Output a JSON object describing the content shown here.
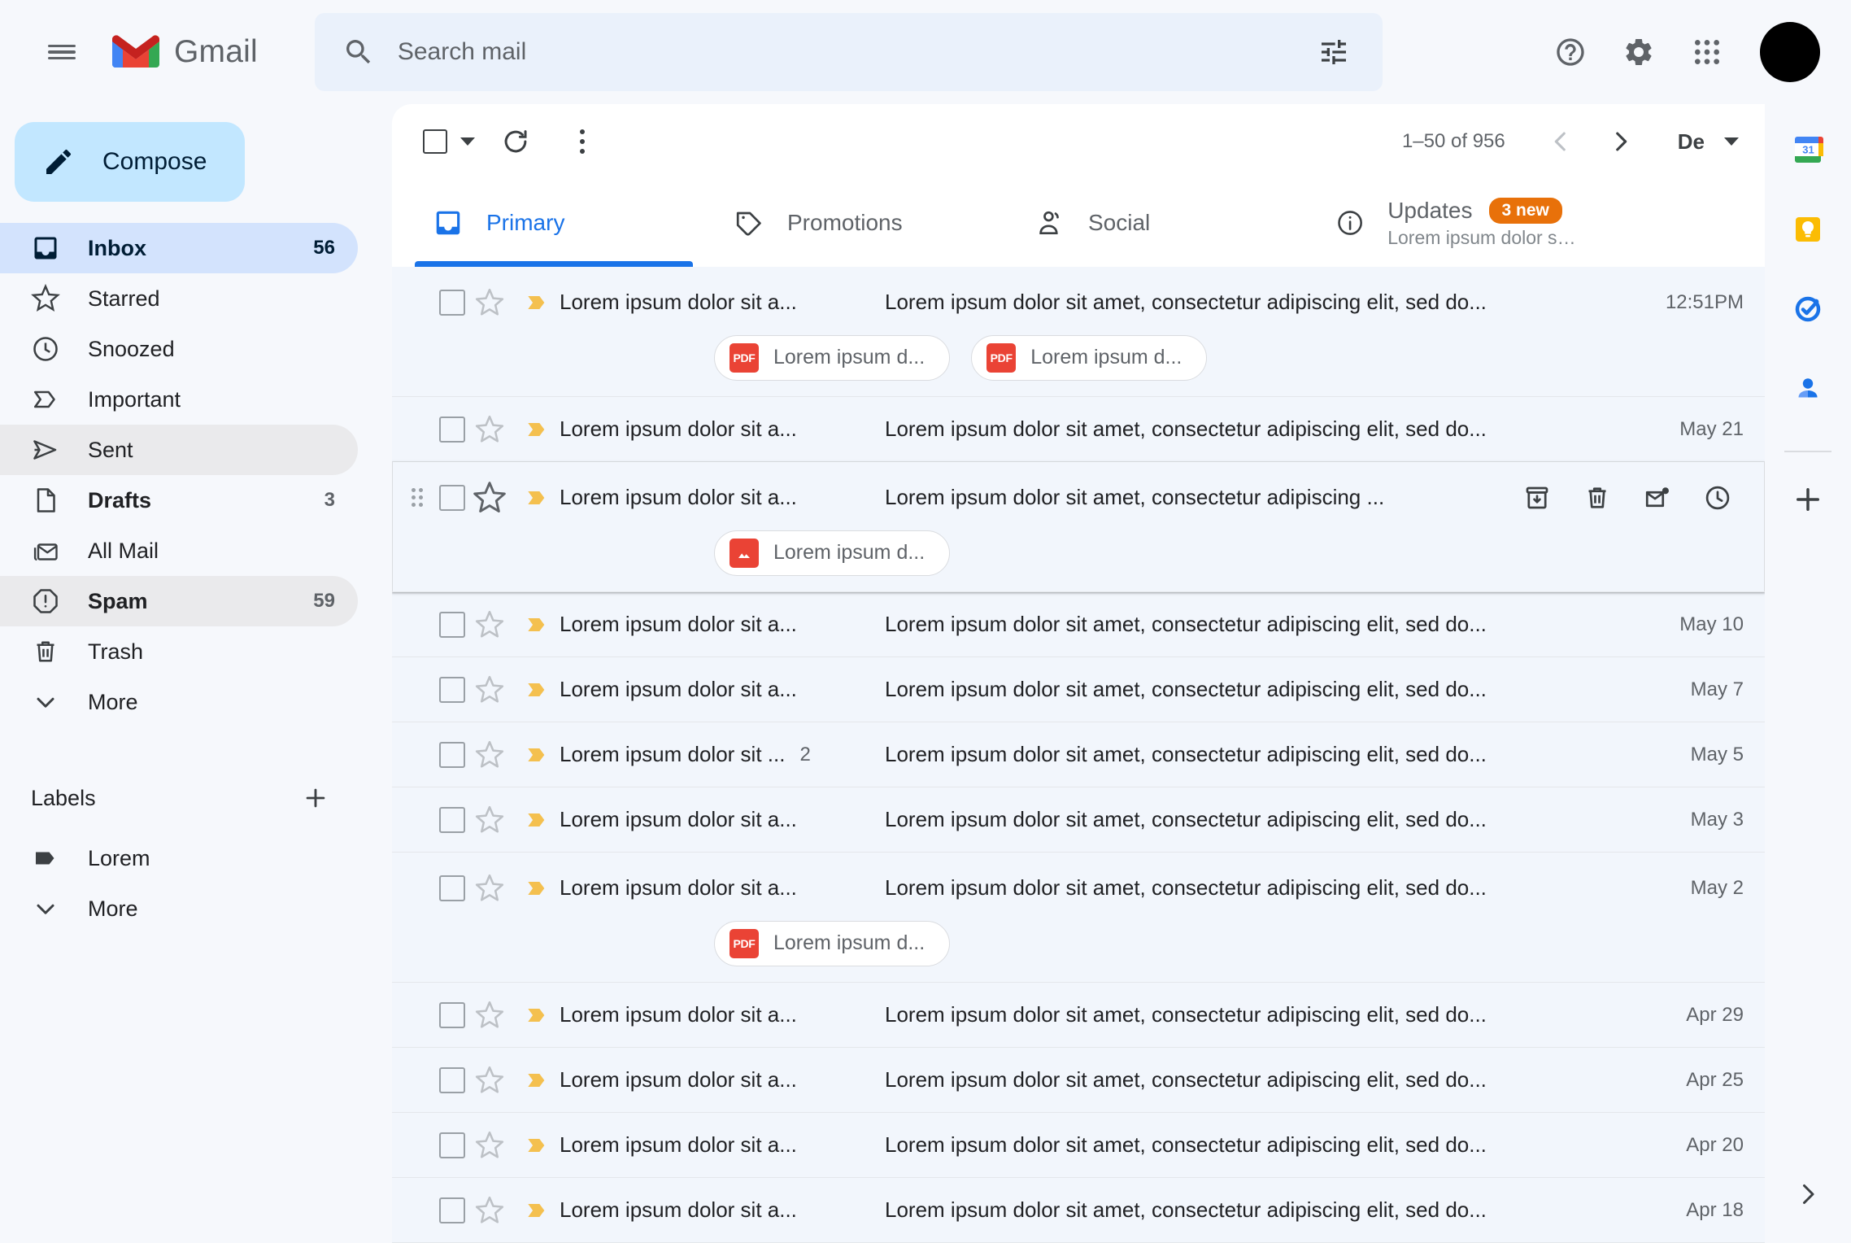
{
  "app": {
    "brand_name": "Gmail",
    "accent_blue": "#1A73E8",
    "badge_orange": "#E8710A",
    "attachment_red": "#EA4335",
    "important_yellow": "#F4C04F"
  },
  "header": {
    "menu_icon": "hamburger-icon",
    "logo_icon": "gmail-logo-icon",
    "search": {
      "icon": "search-icon",
      "placeholder": "Search mail",
      "value": "",
      "filter_icon": "tune-filter-icon"
    },
    "actions": [
      {
        "name": "help-icon",
        "label": "Support"
      },
      {
        "name": "gear-icon",
        "label": "Settings"
      },
      {
        "name": "apps-grid-icon",
        "label": "Google apps"
      }
    ],
    "avatar_label": "Account"
  },
  "sidebar": {
    "compose_label": "Compose",
    "compose_icon": "pencil-icon",
    "items": [
      {
        "label": "Inbox",
        "count": "56",
        "icon": "inbox-icon",
        "state": "active"
      },
      {
        "label": "Starred",
        "count": "",
        "icon": "star-icon",
        "state": "normal"
      },
      {
        "label": "Snoozed",
        "count": "",
        "icon": "clock-icon",
        "state": "normal"
      },
      {
        "label": "Important",
        "count": "",
        "icon": "label-important-icon",
        "state": "normal"
      },
      {
        "label": "Sent",
        "count": "",
        "icon": "send-icon",
        "state": "hovered"
      },
      {
        "label": "Drafts",
        "count": "3",
        "icon": "draft-icon",
        "state": "bold"
      },
      {
        "label": "All Mail",
        "count": "",
        "icon": "all-mail-icon",
        "state": "normal"
      },
      {
        "label": "Spam",
        "count": "59",
        "icon": "spam-icon",
        "state": "bold hovered"
      },
      {
        "label": "Trash",
        "count": "",
        "icon": "trash-icon",
        "state": "normal"
      },
      {
        "label": "More",
        "count": "",
        "icon": "chevron-down-icon",
        "state": "normal"
      }
    ],
    "labels_section": {
      "title": "Labels",
      "add_icon": "plus-icon",
      "items": [
        {
          "label": "Lorem",
          "icon": "label-tag-icon"
        },
        {
          "label": "More",
          "icon": "chevron-down-icon"
        }
      ]
    }
  },
  "toolbar": {
    "select_all_label": "Select",
    "refresh_label": "Refresh",
    "more_label": "More",
    "pager_text": "1–50 of 956",
    "prev_label": "Newer",
    "next_label": "Older",
    "sort_label": "De"
  },
  "tabs": [
    {
      "label": "Primary",
      "icon": "inbox-tab-icon",
      "active": true,
      "badge": "",
      "subtitle": ""
    },
    {
      "label": "Promotions",
      "icon": "tag-tab-icon",
      "active": false,
      "badge": "",
      "subtitle": ""
    },
    {
      "label": "Social",
      "icon": "people-tab-icon",
      "active": false,
      "badge": "",
      "subtitle": ""
    },
    {
      "label": "Updates",
      "icon": "info-tab-icon",
      "active": false,
      "badge": "3 new",
      "subtitle": "Lorem ipsum dolor sit ..."
    }
  ],
  "emails": [
    {
      "sender": "Lorem ipsum dolor sit a...",
      "thread_count": "",
      "subject": "Lorem ipsum dolor sit amet, consectetur adipiscing elit, sed do...",
      "date": "12:51PM",
      "hovered": false,
      "attachments": [
        {
          "label": "Lorem ipsum d...",
          "type": "pdf"
        },
        {
          "label": "Lorem ipsum d...",
          "type": "pdf"
        }
      ]
    },
    {
      "sender": "Lorem ipsum dolor sit a...",
      "thread_count": "",
      "subject": "Lorem ipsum dolor sit amet, consectetur adipiscing elit, sed do...",
      "date": "May 21",
      "hovered": false,
      "attachments": []
    },
    {
      "sender": "Lorem ipsum dolor sit a...",
      "thread_count": "",
      "subject": "Lorem ipsum dolor sit amet, consectetur adipiscing ...",
      "date": "",
      "hovered": true,
      "attachments": [
        {
          "label": "Lorem ipsum d...",
          "type": "image"
        }
      ]
    },
    {
      "sender": "Lorem ipsum dolor sit a...",
      "thread_count": "",
      "subject": "Lorem ipsum dolor sit amet, consectetur adipiscing elit, sed do...",
      "date": "May 10",
      "hovered": false,
      "attachments": []
    },
    {
      "sender": "Lorem ipsum dolor sit a...",
      "thread_count": "",
      "subject": "Lorem ipsum dolor sit amet, consectetur adipiscing elit, sed do...",
      "date": "May 7",
      "hovered": false,
      "attachments": []
    },
    {
      "sender": "Lorem ipsum dolor sit ...",
      "thread_count": "2",
      "subject": "Lorem ipsum dolor sit amet, consectetur adipiscing elit, sed do...",
      "date": "May 5",
      "hovered": false,
      "attachments": []
    },
    {
      "sender": "Lorem ipsum dolor sit a...",
      "thread_count": "",
      "subject": "Lorem ipsum dolor sit amet, consectetur adipiscing elit, sed do...",
      "date": "May 3",
      "hovered": false,
      "attachments": []
    },
    {
      "sender": "Lorem ipsum dolor sit a...",
      "thread_count": "",
      "subject": "Lorem ipsum dolor sit amet, consectetur adipiscing elit, sed do...",
      "date": "May 2",
      "hovered": false,
      "attachments": [
        {
          "label": "Lorem ipsum d...",
          "type": "pdf"
        }
      ]
    },
    {
      "sender": "Lorem ipsum dolor sit a...",
      "thread_count": "",
      "subject": "Lorem ipsum dolor sit amet, consectetur adipiscing elit, sed do...",
      "date": "Apr 29",
      "hovered": false,
      "attachments": []
    },
    {
      "sender": "Lorem ipsum dolor sit a...",
      "thread_count": "",
      "subject": "Lorem ipsum dolor sit amet, consectetur adipiscing elit, sed do...",
      "date": "Apr 25",
      "hovered": false,
      "attachments": []
    },
    {
      "sender": "Lorem ipsum dolor sit a...",
      "thread_count": "",
      "subject": "Lorem ipsum dolor sit amet, consectetur adipiscing elit, sed do...",
      "date": "Apr 20",
      "hovered": false,
      "attachments": []
    },
    {
      "sender": "Lorem ipsum dolor sit a...",
      "thread_count": "",
      "subject": "Lorem ipsum dolor sit amet, consectetur adipiscing elit, sed do...",
      "date": "Apr 18",
      "hovered": false,
      "attachments": []
    }
  ],
  "row_actions": [
    {
      "name": "archive-icon",
      "label": "Archive"
    },
    {
      "name": "delete-icon",
      "label": "Delete"
    },
    {
      "name": "mark-unread-icon",
      "label": "Mark as unread"
    },
    {
      "name": "snooze-icon",
      "label": "Snooze"
    }
  ],
  "side_rail": {
    "apps": [
      {
        "name": "google-calendar-icon",
        "label": "Calendar",
        "day": "31"
      },
      {
        "name": "google-keep-icon",
        "label": "Keep"
      },
      {
        "name": "google-tasks-icon",
        "label": "Tasks"
      },
      {
        "name": "google-contacts-icon",
        "label": "Contacts"
      }
    ],
    "add_label": "Get add-ons",
    "expand_label": "Show side panel"
  }
}
